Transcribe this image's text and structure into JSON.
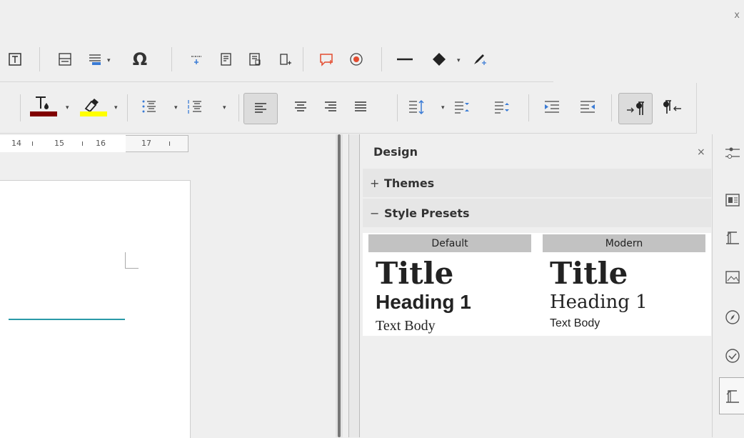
{
  "ruler": {
    "ticks": [
      "14",
      "15",
      "16",
      "17"
    ]
  },
  "sidebar": {
    "deck_title": "Design",
    "close_glyph": "×",
    "panels": [
      {
        "label": "Themes",
        "expanded": false,
        "sign": "+"
      },
      {
        "label": "Style Presets",
        "expanded": true,
        "sign": "−"
      }
    ],
    "presets": [
      {
        "name": "Default",
        "title": "Title",
        "heading": "Heading 1",
        "body": "Text Body"
      },
      {
        "name": "Modern",
        "title": "Title",
        "heading": "Heading 1",
        "body": "Text Body"
      }
    ]
  },
  "colors": {
    "font_color": "#800000",
    "highlight_color": "#ffff00",
    "accent_teal": "#2a9aa8",
    "insert_comment_red": "#e34b2f"
  },
  "toolbar_icons": [
    "text-box-icon",
    "header-footer-icon",
    "field-icon",
    "special-character-icon",
    "cross-reference-icon",
    "footnote-icon",
    "endnote-icon",
    "bookmark-icon",
    "comment-icon",
    "track-changes-icon",
    "line-icon",
    "shapes-icon",
    "draw-function-icon",
    "font-color-icon",
    "highlight-icon",
    "bullets-icon",
    "numbering-icon",
    "align-left-icon",
    "align-center-icon",
    "align-right-icon",
    "justify-icon",
    "line-spacing-icon",
    "increase-para-spacing-icon",
    "decrease-para-spacing-icon",
    "increase-indent-icon",
    "decrease-indent-icon",
    "ltr-icon",
    "rtl-icon"
  ],
  "tab_icons": [
    "properties-icon",
    "styles-icon",
    "gallery-icon",
    "navigator-icon",
    "manage-changes-icon",
    "design-icon"
  ]
}
